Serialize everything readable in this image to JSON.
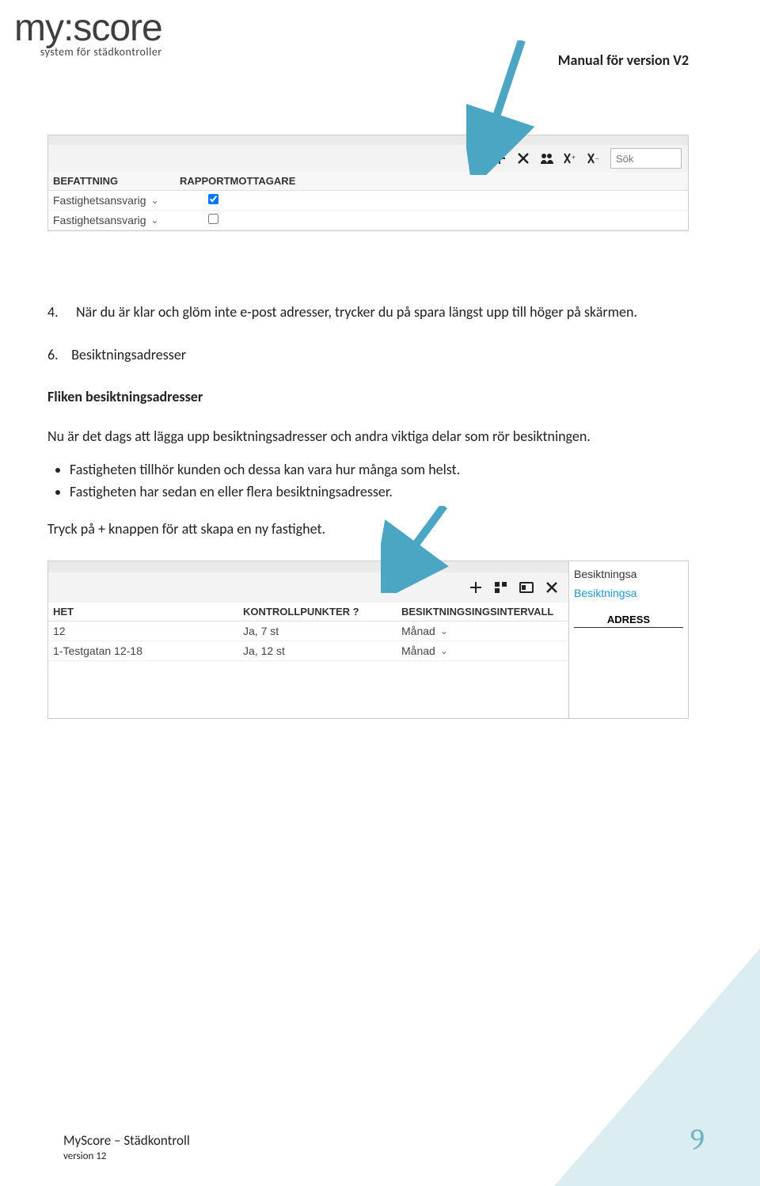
{
  "logo": {
    "word": "my:score",
    "tag": "system för städkontroller"
  },
  "header_right": "Manual för version V2",
  "screenshot1": {
    "search_placeholder": "Sök",
    "columns": {
      "c1": "BEFATTNING",
      "c2": "RAPPORTMOTTAGARE"
    },
    "rows": [
      {
        "role": "Fastighetsansvarig",
        "checked": true
      },
      {
        "role": "Fastighetsansvarig",
        "checked": false
      }
    ],
    "icons": {
      "plus": "plus-icon",
      "close": "close-icon",
      "users": "users-icon",
      "xa": "x-extra-icon-1",
      "xb": "x-extra-icon-2"
    }
  },
  "section": {
    "item4_num": "4.",
    "item4_text": "När du är klar och glöm inte e-post adresser, trycker du på spara längst upp till höger på skärmen.",
    "item6_num": "6.",
    "item6_title": "Besiktningsadresser",
    "subhead": "Fliken besiktningsadresser",
    "para": "Nu är det dags att lägga upp besiktningsadresser och andra viktiga delar som rör besiktningen.",
    "bullets": [
      "Fastigheten tillhör kunden och dessa kan vara hur många som helst.",
      "Fastigheten har sedan en eller flera besiktningsadresser."
    ],
    "trail": "Tryck på + knappen för att skapa en ny fastighet."
  },
  "screenshot2": {
    "columns": {
      "c1": "HET",
      "c2": "KONTROLLPUNKTER ?",
      "c3": "BESIKTNINGSINGSINTERVALL"
    },
    "rows": [
      {
        "het": "12",
        "kp": "Ja, 7 st",
        "intervall": "Månad"
      },
      {
        "het": "1-Testgatan 12-18",
        "kp": "Ja, 12 st",
        "intervall": "Månad"
      }
    ],
    "side": {
      "l1": "Besiktningsa",
      "l2": "Besiktningsa",
      "l3": "ADRESS"
    },
    "icons": {
      "plus": "plus-icon",
      "b": "multi-icon",
      "c": "card-icon",
      "close": "close-icon"
    }
  },
  "footer": {
    "l1": "MyScore – Städkontroll",
    "l2": "version 12"
  },
  "page_number": "9"
}
